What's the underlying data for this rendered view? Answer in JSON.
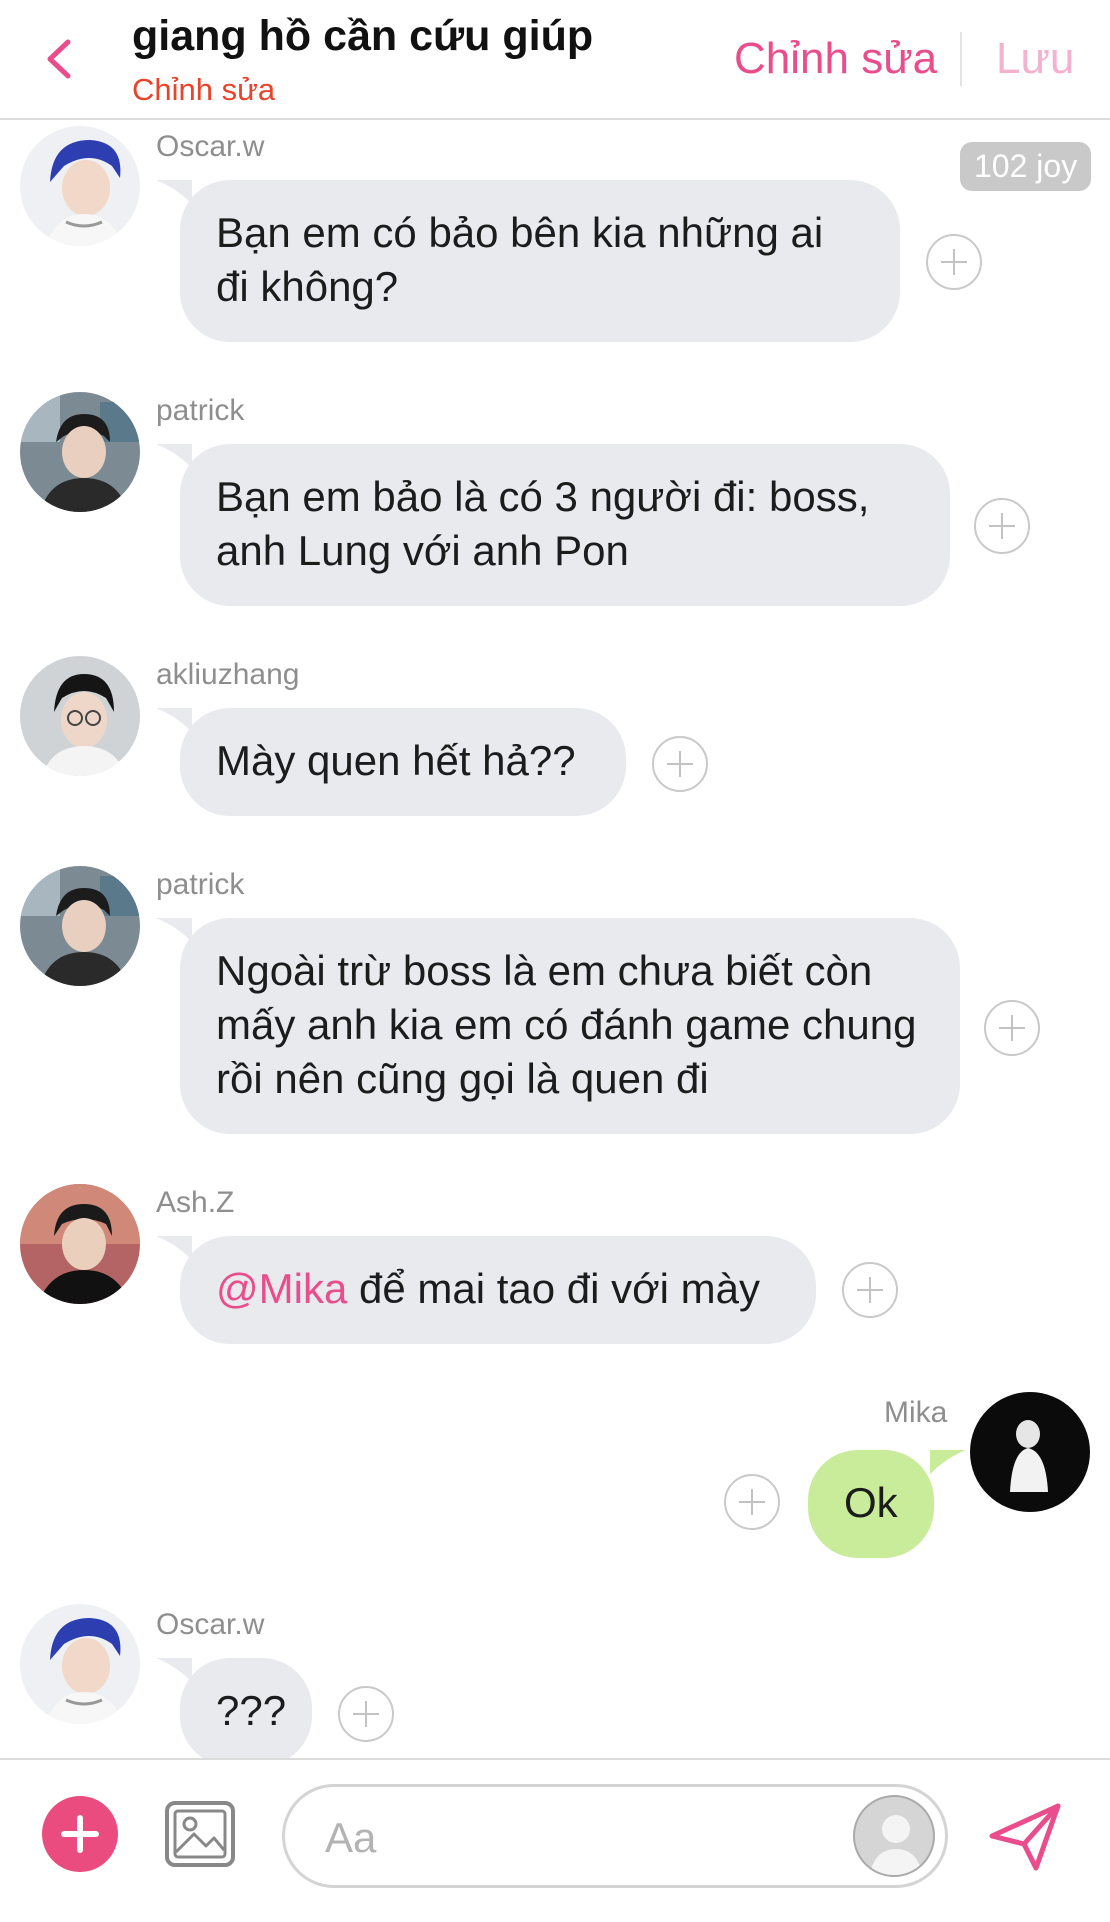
{
  "header": {
    "title": "giang hồ cần cứu giúp",
    "subtitle": "Chỉnh sửa",
    "edit_label": "Chỉnh sửa",
    "save_label": "Lưu"
  },
  "joy_badge": "102 joy",
  "messages": [
    {
      "sender": "Oscar.w",
      "text": "Bạn em có bảo bên kia những ai đi không?"
    },
    {
      "sender": "patrick",
      "text": "Bạn em bảo là có 3 người đi: boss, anh Lung với anh Pon"
    },
    {
      "sender": "akliuzhang",
      "text": "Mày quen hết hả??"
    },
    {
      "sender": "patrick",
      "text": "Ngoài trừ boss là em chưa biết còn mấy anh kia em có đánh game chung rồi nên cũng gọi là quen đi"
    },
    {
      "sender": "Ash.Z",
      "mention": "@Mika",
      "text": " để mai tao đi với mày"
    },
    {
      "sender": "Mika",
      "text": "Ok"
    },
    {
      "sender": "Oscar.w",
      "text": "???"
    }
  ],
  "composer": {
    "placeholder": "Aa"
  },
  "colors": {
    "accent": "#e94d8b",
    "subtitle": "#e8432b",
    "bubble_other": "#e8eaed",
    "bubble_me": "#c8ec9a"
  }
}
